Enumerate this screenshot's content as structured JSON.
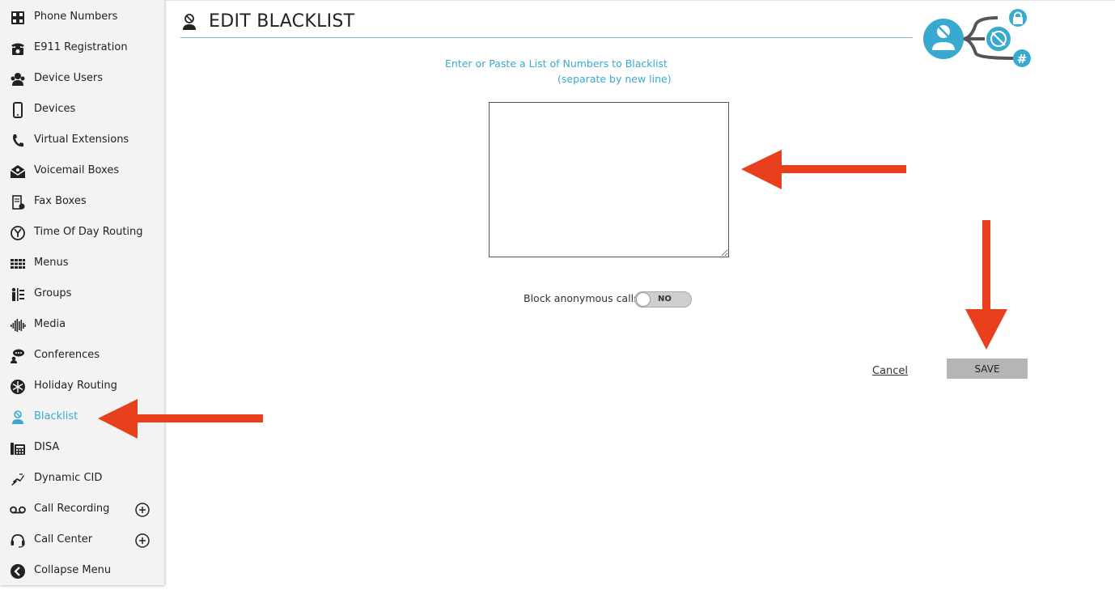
{
  "sidebar": {
    "items": [
      {
        "label": "Phone Numbers",
        "icon": "grid-phone-icon"
      },
      {
        "label": "E911 Registration",
        "icon": "phone-registration-icon"
      },
      {
        "label": "Device Users",
        "icon": "users-icon"
      },
      {
        "label": "Devices",
        "icon": "mobile-device-icon"
      },
      {
        "label": "Virtual Extensions",
        "icon": "handset-icon"
      },
      {
        "label": "Voicemail Boxes",
        "icon": "envelope-icon"
      },
      {
        "label": "Fax Boxes",
        "icon": "fax-icon"
      },
      {
        "label": "Time Of Day Routing",
        "icon": "clock-icon"
      },
      {
        "label": "Menus",
        "icon": "keypad-icon"
      },
      {
        "label": "Groups",
        "icon": "groups-icon"
      },
      {
        "label": "Media",
        "icon": "waveform-icon"
      },
      {
        "label": "Conferences",
        "icon": "conference-icon"
      },
      {
        "label": "Holiday Routing",
        "icon": "snowflake-icon"
      },
      {
        "label": "Blacklist",
        "icon": "blocked-user-icon",
        "active": true
      },
      {
        "label": "DISA",
        "icon": "disa-phone-icon"
      },
      {
        "label": "Dynamic CID",
        "icon": "dynamic-cid-icon"
      },
      {
        "label": "Call Recording",
        "icon": "voicemail-tape-icon",
        "expandable": true
      },
      {
        "label": "Call Center",
        "icon": "headset-icon",
        "expandable": true
      },
      {
        "label": "Collapse Menu",
        "icon": "collapse-left-icon"
      }
    ]
  },
  "header": {
    "title": "EDIT BLACKLIST",
    "icon": "blocked-user-icon"
  },
  "form": {
    "instruction_line1": "Enter or Paste a List of Numbers to Blacklist",
    "instruction_line2": "(separate by new line)",
    "numbers_value": "",
    "anonymous_label": "Block anonymous calls:",
    "anonymous_toggle": "NO",
    "cancel_label": "Cancel",
    "save_label": "SAVE"
  },
  "colors": {
    "accent": "#3aa9cf",
    "arrow": "#e8401c",
    "save_bg": "#b5b5b5",
    "sidebar_bg": "#f3f3f3"
  }
}
